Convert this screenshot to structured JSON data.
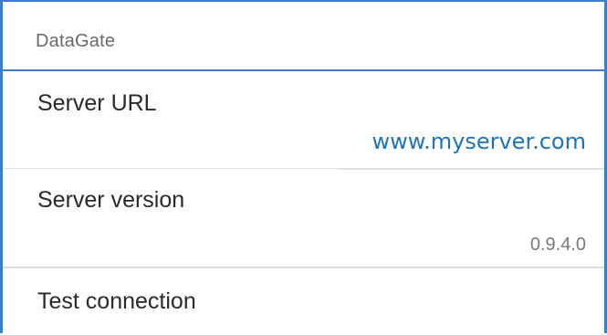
{
  "section": {
    "title": "DataGate"
  },
  "preferences": {
    "server_url": {
      "title": "Server URL",
      "value": "www.myserver.com"
    },
    "server_version": {
      "title": "Server version",
      "value": "0.9.4.0"
    },
    "test_connection": {
      "title": "Test connection"
    }
  },
  "colors": {
    "accent": "#3d7cc8",
    "link_value": "#1f73b7",
    "title_text": "#2a2a2a",
    "summary_text": "#7a7a7a",
    "header_text": "#6b6b6b"
  }
}
